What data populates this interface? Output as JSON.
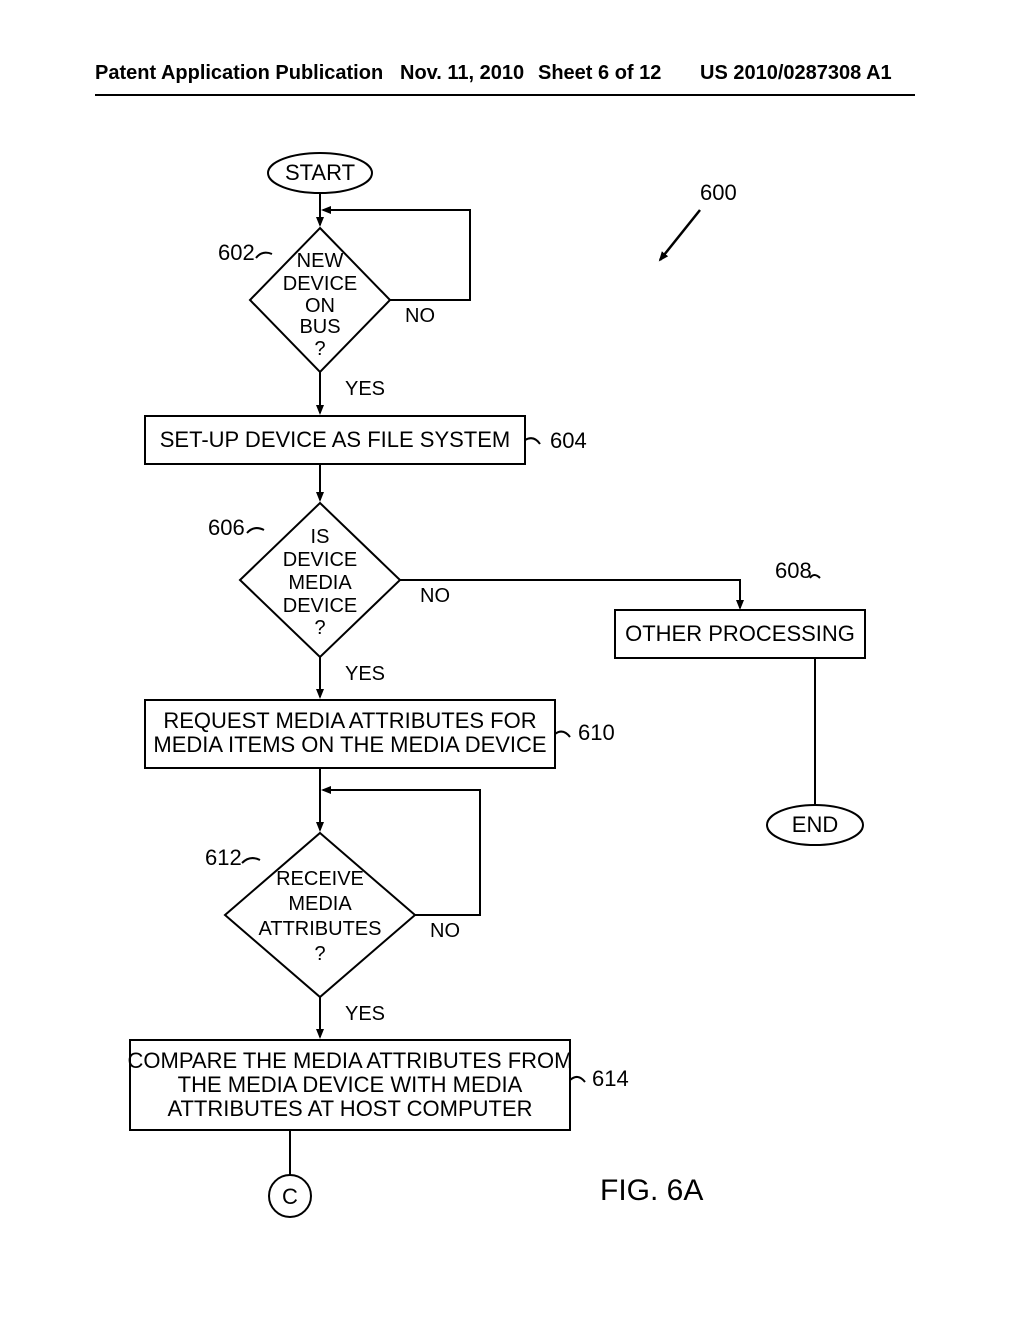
{
  "header": {
    "left": "Patent Application Publication",
    "date": "Nov. 11, 2010",
    "sheet": "Sheet 6 of 12",
    "pub": "US 2010/0287308 A1"
  },
  "refs": {
    "r600": "600",
    "r602": "602",
    "r604": "604",
    "r606": "606",
    "r608": "608",
    "r610": "610",
    "r612": "612",
    "r614": "614"
  },
  "nodes": {
    "start": "START",
    "d602_l1": "NEW",
    "d602_l2": "DEVICE",
    "d602_l3": "ON",
    "d602_l4": "BUS",
    "d602_l5": "?",
    "b604": "SET-UP DEVICE AS FILE SYSTEM",
    "d606_l1": "IS",
    "d606_l2": "DEVICE",
    "d606_l3": "MEDIA",
    "d606_l4": "DEVICE",
    "d606_l5": "?",
    "b608": "OTHER PROCESSING",
    "b610_l1": "REQUEST MEDIA ATTRIBUTES FOR",
    "b610_l2": "MEDIA ITEMS ON THE MEDIA DEVICE",
    "end": "END",
    "d612_l1": "RECEIVE",
    "d612_l2": "MEDIA",
    "d612_l3": "ATTRIBUTES",
    "d612_l4": "?",
    "b614_l1": "COMPARE THE MEDIA ATTRIBUTES FROM",
    "b614_l2": "THE MEDIA DEVICE WITH MEDIA",
    "b614_l3": "ATTRIBUTES AT HOST COMPUTER",
    "connC": "C"
  },
  "labels": {
    "yes": "YES",
    "no": "NO"
  },
  "figure": "FIG. 6A"
}
